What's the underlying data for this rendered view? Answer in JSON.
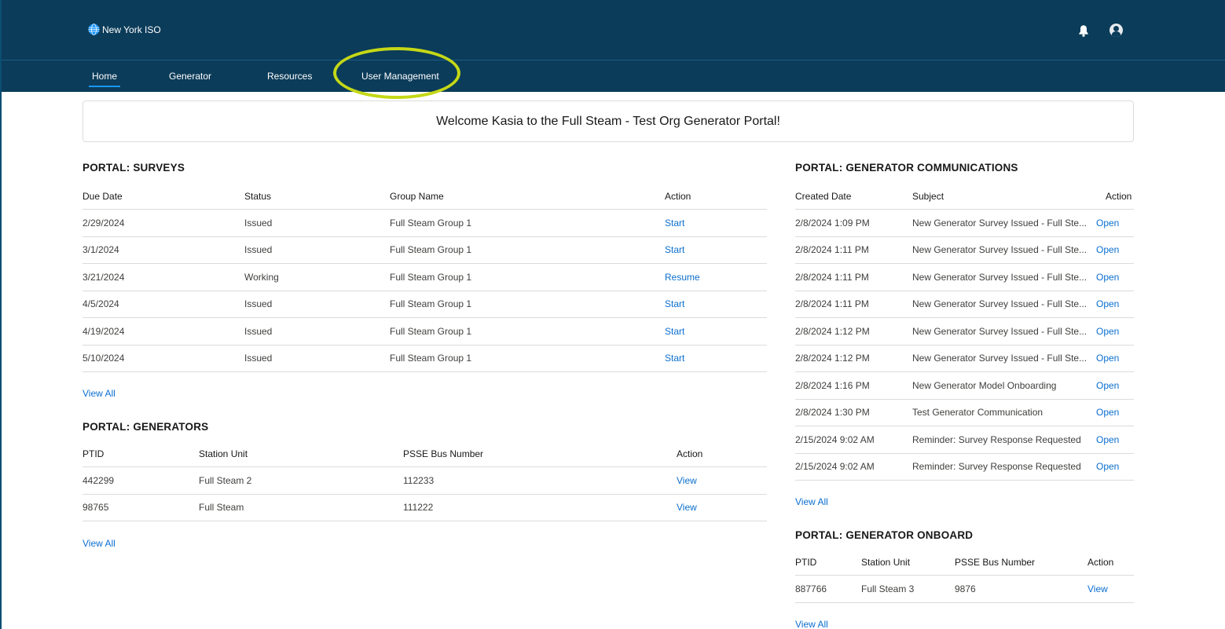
{
  "header": {
    "logo_text": "New York ISO",
    "nav": [
      {
        "label": "Home"
      },
      {
        "label": "Generator"
      },
      {
        "label": "Resources"
      },
      {
        "label": "User Management"
      }
    ]
  },
  "welcome": {
    "text": "Welcome Kasia to the Full Steam - Test Org Generator Portal!"
  },
  "surveys": {
    "title": "PORTAL: SURVEYS",
    "columns": [
      "Due Date",
      "Status",
      "Group Name",
      "Action"
    ],
    "rows": [
      {
        "due": "2/29/2024",
        "status": "Issued",
        "group": "Full Steam Group 1",
        "action": "Start"
      },
      {
        "due": "3/1/2024",
        "status": "Issued",
        "group": "Full Steam Group 1",
        "action": "Start"
      },
      {
        "due": "3/21/2024",
        "status": "Working",
        "group": "Full Steam Group 1",
        "action": "Resume"
      },
      {
        "due": "4/5/2024",
        "status": "Issued",
        "group": "Full Steam Group 1",
        "action": "Start"
      },
      {
        "due": "4/19/2024",
        "status": "Issued",
        "group": "Full Steam Group 1",
        "action": "Start"
      },
      {
        "due": "5/10/2024",
        "status": "Issued",
        "group": "Full Steam Group 1",
        "action": "Start"
      }
    ],
    "view_all": "View All"
  },
  "generators": {
    "title": "PORTAL: GENERATORS",
    "columns": [
      "PTID",
      "Station Unit",
      "PSSE Bus Number",
      "Action"
    ],
    "rows": [
      {
        "ptid": "442299",
        "station": "Full Steam 2",
        "bus": "112233",
        "action": "View"
      },
      {
        "ptid": "98765",
        "station": "Full Steam",
        "bus": "111222",
        "action": "View"
      }
    ],
    "view_all": "View All"
  },
  "communications": {
    "title": "PORTAL: GENERATOR COMMUNICATIONS",
    "columns": [
      "Created Date",
      "Subject",
      "Action"
    ],
    "rows": [
      {
        "created": "2/8/2024 1:09 PM",
        "subject": "New Generator Survey Issued - Full Ste...",
        "action": "Open"
      },
      {
        "created": "2/8/2024 1:11 PM",
        "subject": "New Generator Survey Issued - Full Ste...",
        "action": "Open"
      },
      {
        "created": "2/8/2024 1:11 PM",
        "subject": "New Generator Survey Issued - Full Ste...",
        "action": "Open"
      },
      {
        "created": "2/8/2024 1:11 PM",
        "subject": "New Generator Survey Issued - Full Ste...",
        "action": "Open"
      },
      {
        "created": "2/8/2024 1:12 PM",
        "subject": "New Generator Survey Issued - Full Ste...",
        "action": "Open"
      },
      {
        "created": "2/8/2024 1:12 PM",
        "subject": "New Generator Survey Issued - Full Ste...",
        "action": "Open"
      },
      {
        "created": "2/8/2024 1:16 PM",
        "subject": "New Generator Model Onboarding",
        "action": "Open"
      },
      {
        "created": "2/8/2024 1:30 PM",
        "subject": "Test Generator Communication",
        "action": "Open"
      },
      {
        "created": "2/15/2024 9:02 AM",
        "subject": "Reminder: Survey Response Requested",
        "action": "Open"
      },
      {
        "created": "2/15/2024 9:02 AM",
        "subject": "Reminder: Survey Response Requested",
        "action": "Open"
      }
    ],
    "view_all": "View All"
  },
  "onboard": {
    "title": "PORTAL: GENERATOR ONBOARD",
    "columns": [
      "PTID",
      "Station Unit",
      "PSSE Bus Number",
      "Action"
    ],
    "rows": [
      {
        "ptid": "887766",
        "station": "Full Steam 3",
        "bus": "9876",
        "action": "View"
      }
    ],
    "view_all": "View All"
  },
  "icons": {
    "logo": "globe-icon",
    "notifications": "bell-icon",
    "user": "avatar-icon"
  },
  "colors": {
    "header_bg": "#0b3c5a",
    "link": "#0b6fcf",
    "highlight": "#c5d816",
    "active_tab": "#1b96ff"
  }
}
